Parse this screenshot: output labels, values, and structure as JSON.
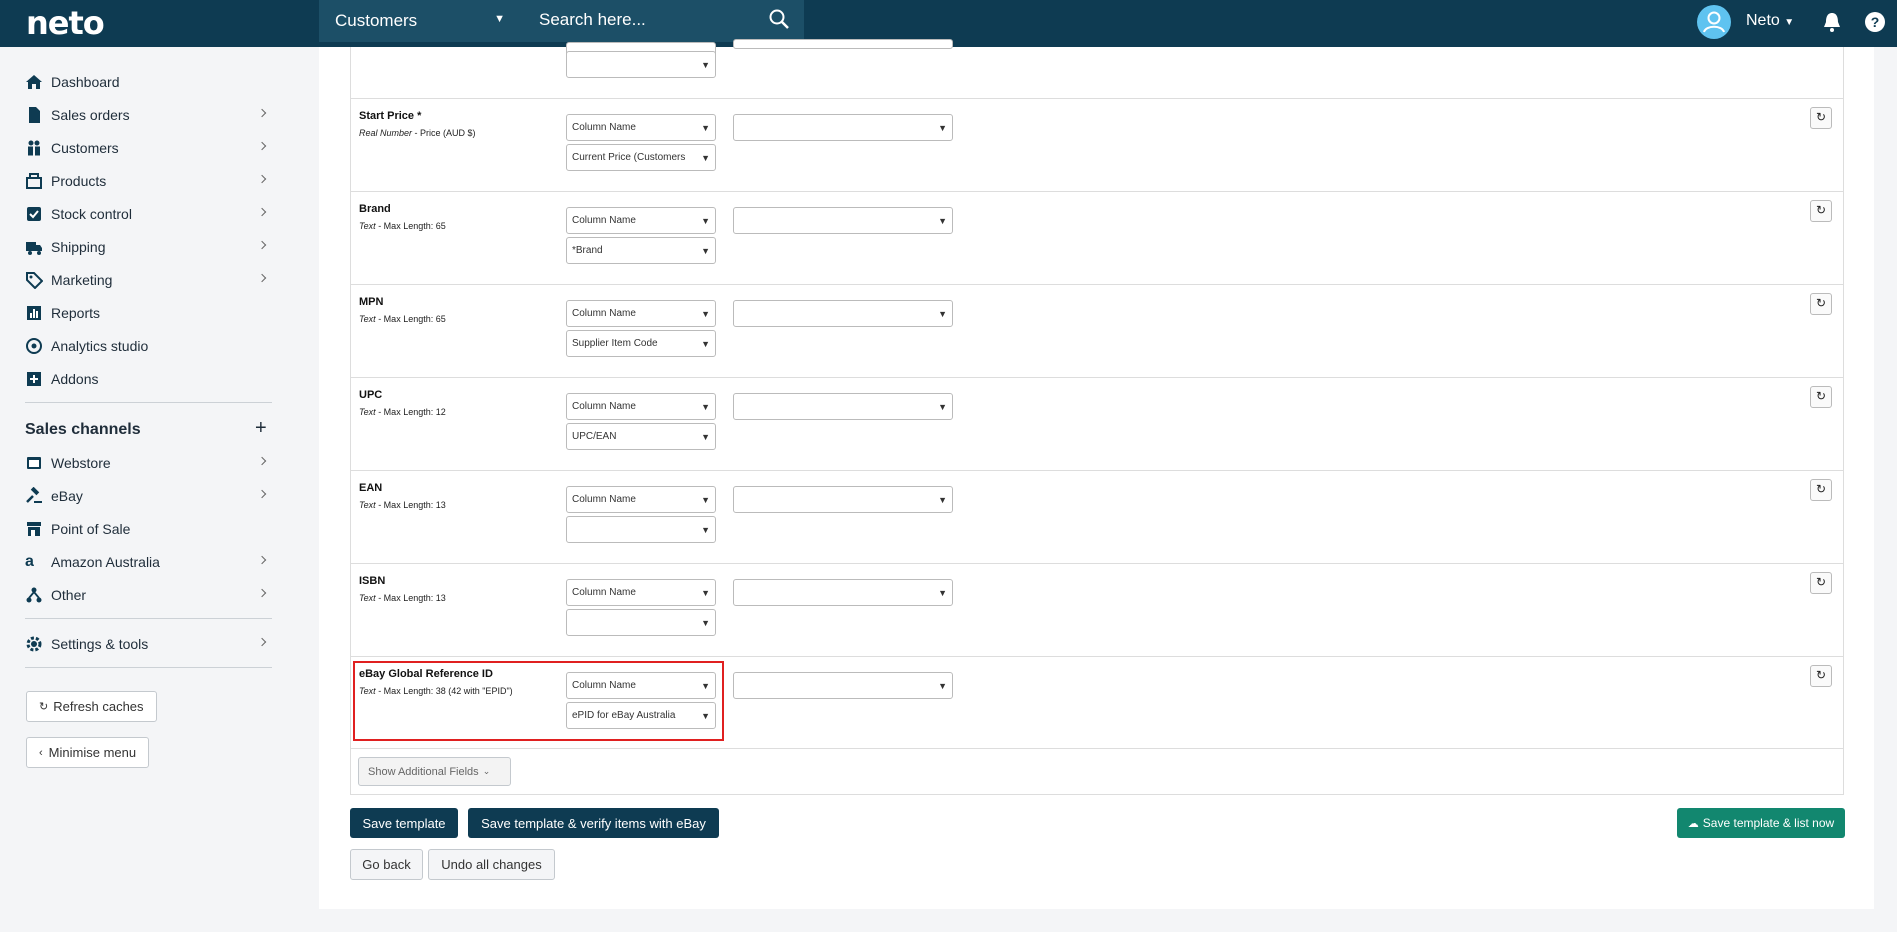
{
  "topbar": {
    "logo": "neto",
    "search_category": "Customers",
    "search_placeholder": "Search here...",
    "user": "Neto",
    "help": "?"
  },
  "sidebar": {
    "items": [
      {
        "label": "Dashboard"
      },
      {
        "label": "Sales orders"
      },
      {
        "label": "Customers"
      },
      {
        "label": "Products"
      },
      {
        "label": "Stock control"
      },
      {
        "label": "Shipping"
      },
      {
        "label": "Marketing"
      },
      {
        "label": "Reports"
      },
      {
        "label": "Analytics studio"
      },
      {
        "label": "Addons"
      }
    ],
    "channels_title": "Sales channels",
    "channels": [
      {
        "label": "Webstore"
      },
      {
        "label": "eBay"
      },
      {
        "label": "Point of Sale"
      },
      {
        "label": "Amazon Australia"
      },
      {
        "label": "Other"
      }
    ],
    "settings": "Settings & tools",
    "refresh_caches": "Refresh caches",
    "minimise_menu": "Minimise menu"
  },
  "fields": [
    {
      "title": "Start Price *",
      "type": "Real Number",
      "desc": " - Price (AUD $)",
      "col": "Column Name",
      "source": "Current Price (Customers"
    },
    {
      "title": "Brand",
      "type": "Text",
      "desc": " - Max Length: 65",
      "col": "Column Name",
      "source": "*Brand"
    },
    {
      "title": "MPN",
      "type": "Text",
      "desc": " - Max Length: 65",
      "col": "Column Name",
      "source": "Supplier Item Code"
    },
    {
      "title": "UPC",
      "type": "Text",
      "desc": " - Max Length: 12",
      "col": "Column Name",
      "source": "UPC/EAN"
    },
    {
      "title": "EAN",
      "type": "Text",
      "desc": " - Max Length: 13",
      "col": "Column Name",
      "source": ""
    },
    {
      "title": "ISBN",
      "type": "Text",
      "desc": " - Max Length: 13",
      "col": "Column Name",
      "source": ""
    },
    {
      "title": "eBay Global Reference ID",
      "type": "Text",
      "desc": " - Max Length: 38 (42 with \"EPID\")",
      "col": "Column Name",
      "source": "ePID for eBay Australia"
    }
  ],
  "actions": {
    "show_additional": "Show Additional Fields",
    "save_template": "Save template",
    "save_verify": "Save template & verify items with eBay",
    "save_list": "Save template & list now",
    "go_back": "Go back",
    "undo": "Undo all changes"
  },
  "colors": {
    "topbar": "#0e3b52",
    "green": "#12876f",
    "highlight": "#e02020"
  }
}
